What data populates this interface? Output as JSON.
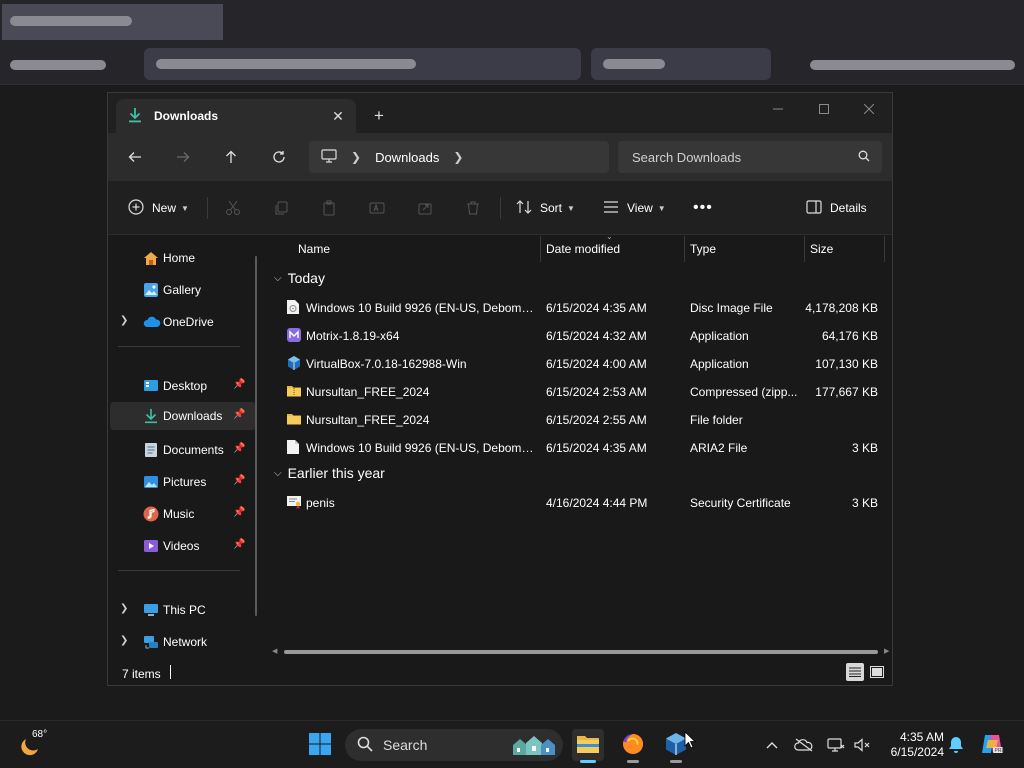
{
  "window": {
    "tab_title": "Downloads",
    "address_crumb": "Downloads",
    "search_placeholder": "Search Downloads"
  },
  "commands": {
    "new": "New",
    "sort": "Sort",
    "view": "View",
    "details": "Details"
  },
  "sidebar": {
    "items": [
      {
        "label": "Home",
        "icon": "home-icon"
      },
      {
        "label": "Gallery",
        "icon": "gallery-icon"
      },
      {
        "label": "OneDrive",
        "icon": "onedrive-icon"
      },
      {
        "label": "Desktop",
        "icon": "desktop-icon"
      },
      {
        "label": "Downloads",
        "icon": "download-icon"
      },
      {
        "label": "Documents",
        "icon": "documents-icon"
      },
      {
        "label": "Pictures",
        "icon": "pictures-icon"
      },
      {
        "label": "Music",
        "icon": "music-icon"
      },
      {
        "label": "Videos",
        "icon": "videos-icon"
      },
      {
        "label": "This PC",
        "icon": "this-pc-icon"
      },
      {
        "label": "Network",
        "icon": "network-icon"
      }
    ]
  },
  "columns": {
    "name": "Name",
    "date": "Date modified",
    "type": "Type",
    "size": "Size"
  },
  "groups": {
    "today": "Today",
    "earlier": "Earlier this year"
  },
  "files": [
    {
      "name": "Windows 10 Build 9926 (EN-US, Debomb...",
      "date": "6/15/2024 4:35 AM",
      "type": "Disc Image File",
      "size": "4,178,208 KB",
      "icon": "disc-image-icon"
    },
    {
      "name": "Motrix-1.8.19-x64",
      "date": "6/15/2024 4:32 AM",
      "type": "Application",
      "size": "64,176 KB",
      "icon": "motrix-app-icon"
    },
    {
      "name": "VirtualBox-7.0.18-162988-Win",
      "date": "6/15/2024 4:00 AM",
      "type": "Application",
      "size": "107,130 KB",
      "icon": "virtualbox-app-icon"
    },
    {
      "name": "Nursultan_FREE_2024",
      "date": "6/15/2024 2:53 AM",
      "type": "Compressed (zipp...",
      "size": "177,667 KB",
      "icon": "zip-folder-icon"
    },
    {
      "name": "Nursultan_FREE_2024",
      "date": "6/15/2024 2:55 AM",
      "type": "File folder",
      "size": "",
      "icon": "folder-icon"
    },
    {
      "name": "Windows 10 Build 9926 (EN-US, Debomb...",
      "date": "6/15/2024 4:35 AM",
      "type": "ARIA2 File",
      "size": "3 KB",
      "icon": "file-icon"
    }
  ],
  "earlier_files": [
    {
      "name": "penis",
      "date": "4/16/2024 4:44 PM",
      "type": "Security Certificate",
      "size": "3 KB",
      "icon": "certificate-icon"
    }
  ],
  "status": {
    "items_count": "7 items"
  },
  "taskbar": {
    "temperature": "68°",
    "search_label": "Search",
    "time": "4:35 AM",
    "date": "6/15/2024"
  }
}
